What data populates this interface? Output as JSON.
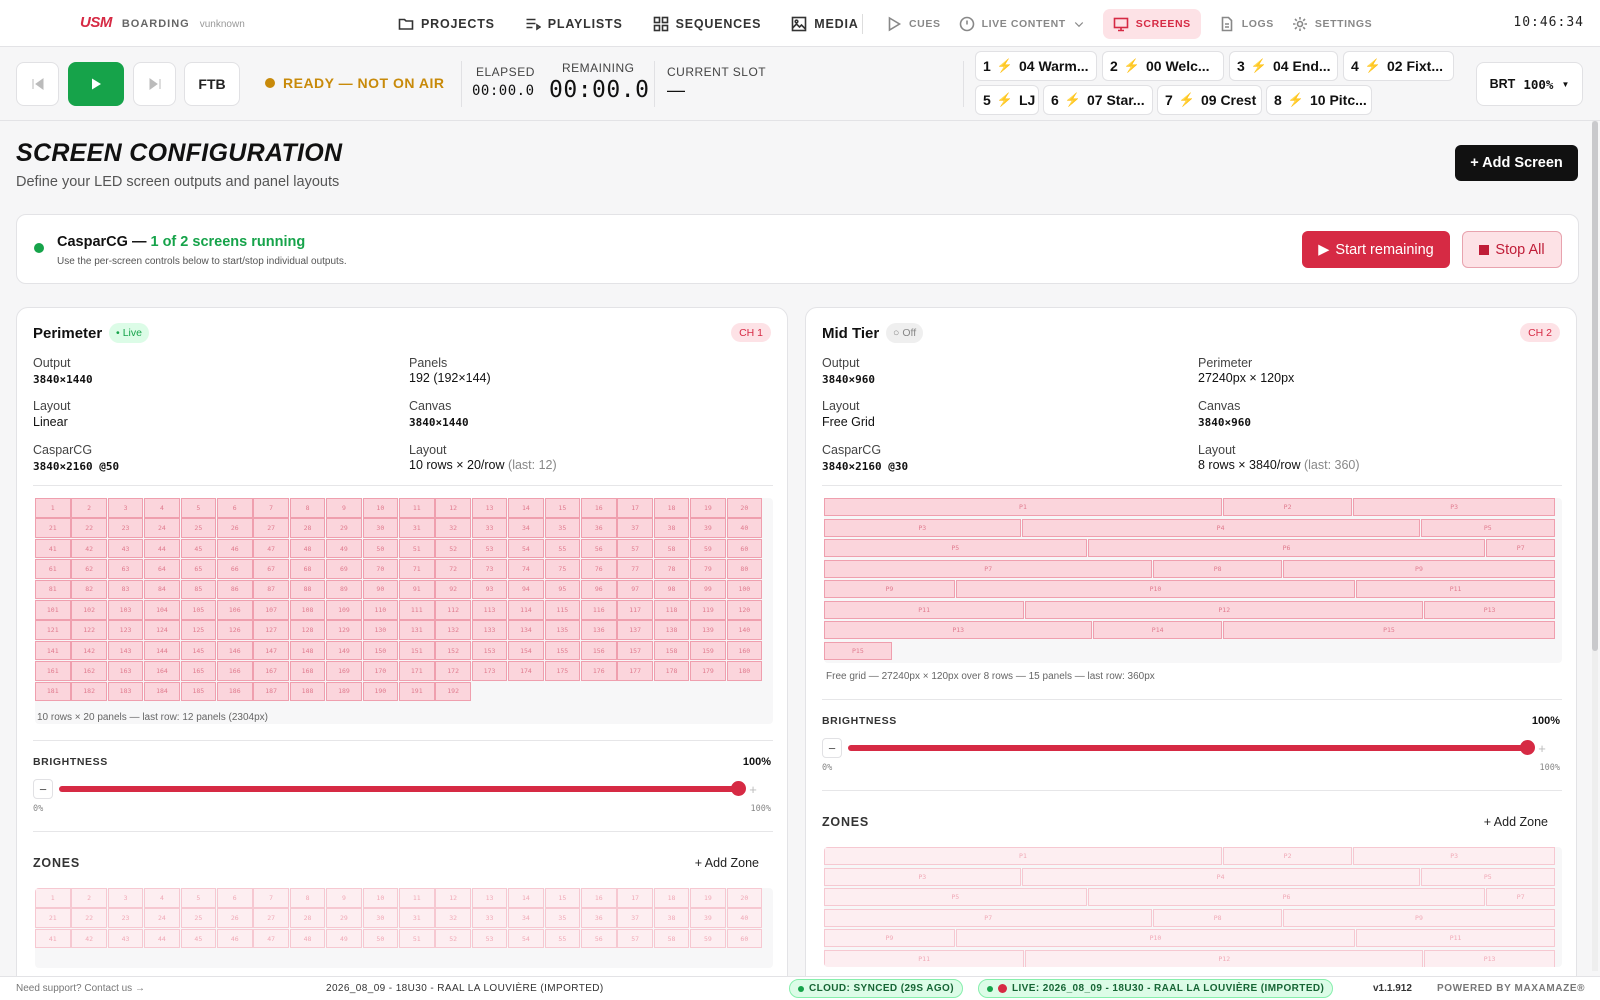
{
  "brand": {
    "logo": "USM",
    "project": "BOARDING",
    "user": "vunknown"
  },
  "nav": {
    "main": [
      {
        "label": "PROJECTS",
        "icon": "folder-icon"
      },
      {
        "label": "PLAYLISTS",
        "icon": "playlist-icon"
      },
      {
        "label": "SEQUENCES",
        "icon": "grid-icon"
      },
      {
        "label": "MEDIA",
        "icon": "image-icon"
      }
    ],
    "sub": [
      {
        "label": "CUES",
        "icon": "play-outline-icon"
      },
      {
        "label": "LIVE CONTENT",
        "icon": "live-circle-icon"
      },
      {
        "label": "SCREENS",
        "icon": "monitor-icon",
        "active": true
      },
      {
        "label": "LOGS",
        "icon": "document-icon"
      },
      {
        "label": "SETTINGS",
        "icon": "gear-icon"
      }
    ],
    "clock": "10:46:34"
  },
  "transport": {
    "ftb": "FTB",
    "status": "READY — NOT ON AIR",
    "status_color": "#c88a0a",
    "elapsed_label": "ELAPSED",
    "elapsed": "00:00.0",
    "remaining_label": "REMAINING",
    "remaining": "00:00.0",
    "slot_label": "CURRENT SLOT",
    "slot_value": "—",
    "slots": [
      {
        "num": "1",
        "name": "04 Warm..."
      },
      {
        "num": "2",
        "name": "00 Welc..."
      },
      {
        "num": "3",
        "name": "04 End..."
      },
      {
        "num": "4",
        "name": "02 Fixt..."
      },
      {
        "num": "5",
        "name": "LJ"
      },
      {
        "num": "6",
        "name": "07 Star..."
      },
      {
        "num": "7",
        "name": "09 Crest"
      },
      {
        "num": "8",
        "name": "10 Pitc..."
      }
    ],
    "brt_label": "BRT",
    "brt_value": "100%"
  },
  "page": {
    "title": "SCREEN CONFIGURATION",
    "subtitle": "Define your LED screen outputs and panel layouts",
    "add_screen": "+ Add Screen"
  },
  "caspar": {
    "name": "CasparCG",
    "sep": " — ",
    "running": "1 of 2 screens running",
    "hint": "Use the per-screen controls below to start/stop individual outputs.",
    "start": "Start remaining",
    "stop": "Stop All"
  },
  "screens": [
    {
      "name": "Perimeter",
      "status": "Live",
      "channel": "CH 1",
      "left": [
        {
          "k": "Output",
          "v": "3840×1440",
          "mono": true
        },
        {
          "k": "Layout",
          "v": "Linear"
        },
        {
          "k": "CasparCG",
          "v": "3840×2160 @50",
          "mono": true
        }
      ],
      "right": [
        {
          "k": "Panels",
          "v": "192 (192×144)"
        },
        {
          "k": "Canvas",
          "v": "3840×1440",
          "mono": true
        },
        {
          "k": "Layout",
          "v": "10 rows × 20/row",
          "muted": "(last: 12)"
        }
      ],
      "panel_count": 192,
      "cols": 20,
      "caption": "10 rows × 20 panels — last row: 12 panels (2304px)",
      "brightness_label": "BRIGHTNESS",
      "brightness": 100,
      "brightness_text": "100%",
      "min_text": "0%",
      "max_text": "100%",
      "zones_label": "ZONES",
      "add_zone": "+ Add Zone"
    },
    {
      "name": "Mid Tier",
      "status": "Off",
      "channel": "CH 2",
      "left": [
        {
          "k": "Output",
          "v": "3840×960",
          "mono": true
        },
        {
          "k": "Layout",
          "v": "Free Grid"
        },
        {
          "k": "CasparCG",
          "v": "3840×2160 @30",
          "mono": true
        }
      ],
      "right": [
        {
          "k": "Perimeter",
          "v": "27240px × 120px"
        },
        {
          "k": "Canvas",
          "v": "3840×960",
          "mono": true
        },
        {
          "k": "Layout",
          "v": "8 rows × 3840/row",
          "muted": "(last: 360)"
        }
      ],
      "free_rows": [
        [
          [
            "P1",
            0.545
          ],
          [
            "P2",
            0.178
          ],
          [
            "P3",
            0.277
          ]
        ],
        [
          [
            "P3",
            0.27
          ],
          [
            "P4",
            0.545
          ],
          [
            "P5",
            0.185
          ]
        ],
        [
          [
            "P5",
            0.36
          ],
          [
            "P6",
            0.545
          ],
          [
            "P7",
            0.095
          ]
        ],
        [
          [
            "P7",
            0.45
          ],
          [
            "P8",
            0.177
          ],
          [
            "P9",
            0.373
          ]
        ],
        [
          [
            "P9",
            0.18
          ],
          [
            "P10",
            0.547
          ],
          [
            "P11",
            0.273
          ]
        ],
        [
          [
            "P11",
            0.275
          ],
          [
            "P12",
            0.545
          ],
          [
            "P13",
            0.18
          ]
        ],
        [
          [
            "P13",
            0.368
          ],
          [
            "P14",
            0.177
          ],
          [
            "P15",
            0.455
          ]
        ],
        [
          [
            "P15",
            0.094
          ]
        ]
      ],
      "caption": "Free grid — 27240px × 120px over 8 rows — 15 panels — last row: 360px",
      "brightness_label": "BRIGHTNESS",
      "brightness": 100,
      "brightness_text": "100%",
      "min_text": "0%",
      "max_text": "100%",
      "zones_label": "ZONES",
      "add_zone": "+ Add Zone"
    }
  ],
  "footer": {
    "support": "Need support? Contact us →",
    "project": "2026_08_09 - 18U30 - RAAL LA LOUVIÈRE (IMPORTED)",
    "cloud": "CLOUD: SYNCED (29S AGO)",
    "live": "LIVE: 2026_08_09 - 18U30 - RAAL LA LOUVIÈRE (IMPORTED)",
    "version": "v1.1.912",
    "powered": "POWERED BY MAXAMAZE®"
  },
  "colors": {
    "accent": "#d62a44",
    "success": "#16a34a",
    "warning": "#c88a0a"
  }
}
